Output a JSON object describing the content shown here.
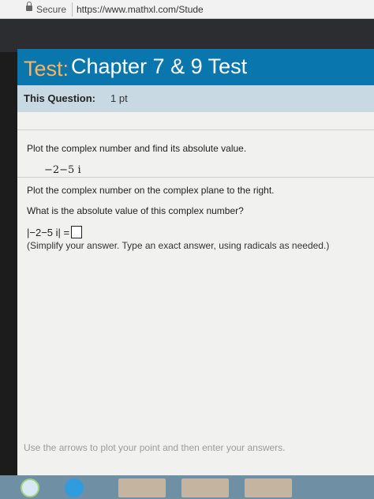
{
  "browser": {
    "secure_label": "Secure",
    "url": "https://www.mathxl.com/Stude"
  },
  "header": {
    "title_prefix": "Test:",
    "title_main": "Chapter 7 & 9 Test"
  },
  "question_bar": {
    "label": "This Question:",
    "points": "1 pt"
  },
  "question": {
    "instruction": "Plot the complex number and find its absolute value.",
    "number": "−2−5 i",
    "plot_prompt": "Plot the complex number on the complex plane to the right.",
    "absolute_value_prompt": "What is the absolute value of this complex number?",
    "answer_expression": "|−2−5 i| =",
    "answer_value": "",
    "hint": "(Simplify your answer. Type an exact answer, using radicals as needed.)",
    "footer_hint": "Use the arrows to plot your point and then enter your answers."
  },
  "colors": {
    "title_bar": "#0a76ae",
    "title_prefix": "#ffb35c",
    "question_bar": "#c9d9e3",
    "content_bg": "#f1f1ef"
  }
}
